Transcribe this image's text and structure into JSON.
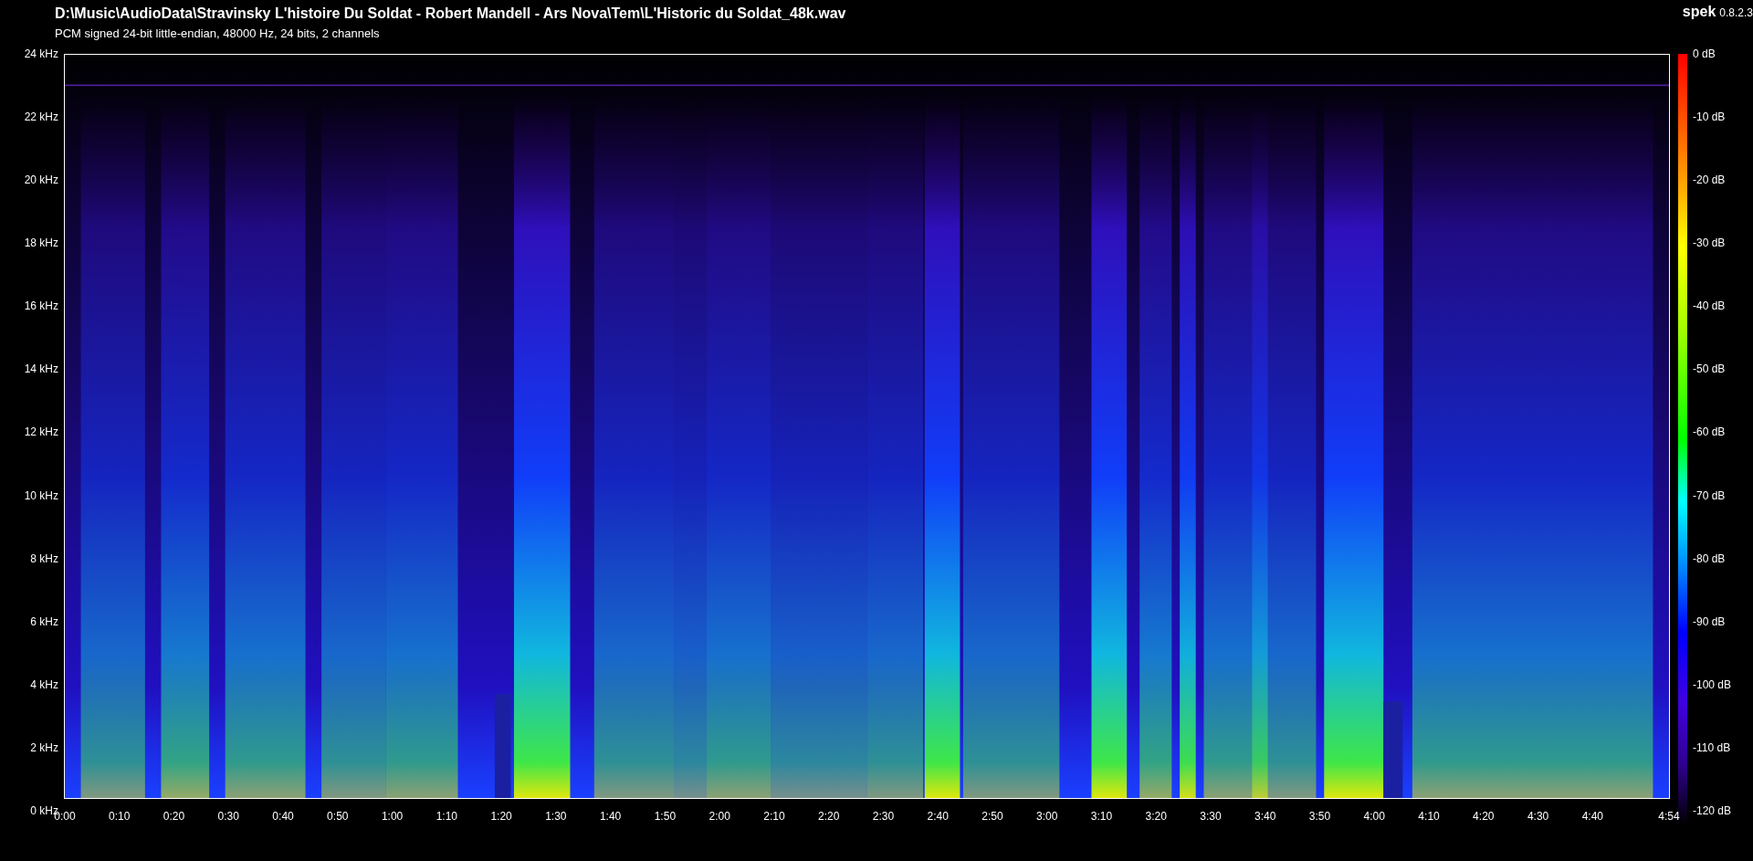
{
  "file_path": "D:\\Music\\AudioData\\Stravinsky L'histoire Du Soldat - Robert Mandell - Ars Nova\\Tem\\L'Historic du Soldat_48k.wav",
  "format_info": "PCM signed 24-bit little-endian, 48000 Hz, 24 bits, 2 channels",
  "app": {
    "name": "spek",
    "version": "0.8.2.3"
  },
  "frequency_axis": [
    "24 kHz",
    "22 kHz",
    "20 kHz",
    "18 kHz",
    "16 kHz",
    "14 kHz",
    "12 kHz",
    "10 kHz",
    "8 kHz",
    "6 kHz",
    "4 kHz",
    "2 kHz",
    "0 kHz"
  ],
  "time_axis": [
    "0:00",
    "0:10",
    "0:20",
    "0:30",
    "0:40",
    "0:50",
    "1:00",
    "1:10",
    "1:20",
    "1:30",
    "1:40",
    "1:50",
    "2:00",
    "2:10",
    "2:20",
    "2:30",
    "2:40",
    "2:50",
    "3:00",
    "3:10",
    "3:20",
    "3:30",
    "3:40",
    "3:50",
    "4:00",
    "4:10",
    "4:20",
    "4:30",
    "4:40",
    "4:54"
  ],
  "db_scale": [
    "0 dB",
    "-10 dB",
    "-20 dB",
    "-30 dB",
    "-40 dB",
    "-50 dB",
    "-60 dB",
    "-70 dB",
    "-80 dB",
    "-90 dB",
    "-100 dB",
    "-110 dB",
    "-120 dB"
  ]
}
